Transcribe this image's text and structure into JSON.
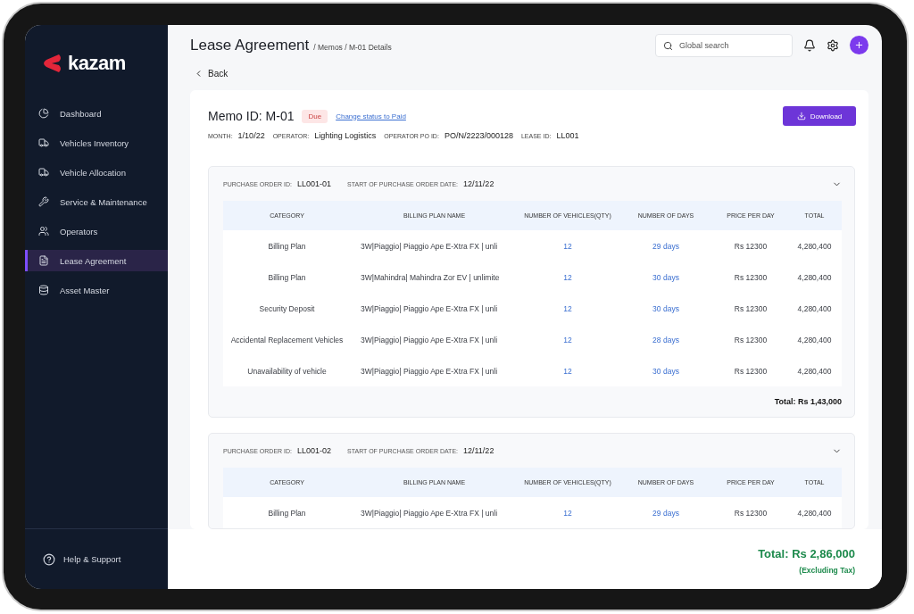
{
  "sidebar": {
    "logo": "kazam",
    "items": [
      {
        "label": "Dashboard",
        "selected": false
      },
      {
        "label": "Vehicles Inventory",
        "selected": false
      },
      {
        "label": "Vehicle Allocation",
        "selected": false
      },
      {
        "label": "Service & Maintenance",
        "selected": false
      },
      {
        "label": "Operators",
        "selected": false
      },
      {
        "label": "Lease Agreement",
        "selected": true
      },
      {
        "label": "Asset Master",
        "selected": false
      }
    ],
    "help": "Help & Support"
  },
  "header": {
    "title": "Lease Agreement",
    "breadcrumb": "/ Memos / M-01 Details",
    "search_placeholder": "Global search"
  },
  "back": "Back",
  "memo": {
    "title": "Memo ID: M-01",
    "status": "Due",
    "status_link": "Change status to Paid",
    "download": "Download",
    "meta": [
      {
        "label": "MONTH:",
        "value": "1/10/22"
      },
      {
        "label": "OPERATOR:",
        "value": "Lighting Logistics"
      },
      {
        "label": "OPERATOR PO ID:",
        "value": "PO/N/2223/000128"
      },
      {
        "label": "LEASE ID:",
        "value": "LL001"
      }
    ]
  },
  "purchase_orders": [
    {
      "id_label": "PURCHASE ORDER ID:",
      "id": "LL001-01",
      "date_label": "START OF PURCHASE ORDER DATE:",
      "date": "12/11/22",
      "columns": [
        "CATEGORY",
        "BILLING PLAN NAME",
        "NUMBER OF VEHICLES(QTY)",
        "NUMBER OF DAYS",
        "PRICE PER DAY",
        "TOTAL"
      ],
      "rows": [
        [
          "Billing Plan",
          "3W|Piaggio| Piaggio Ape E-Xtra FX | unli",
          "12",
          "29 days",
          "Rs 12300",
          "4,280,400"
        ],
        [
          "Billing Plan",
          "3W|Mahindra| Mahindra Zor EV | unlimite",
          "12",
          "30 days",
          "Rs 12300",
          "4,280,400"
        ],
        [
          "Security Deposit",
          "3W|Piaggio| Piaggio Ape E-Xtra FX | unli",
          "12",
          "30 days",
          "Rs 12300",
          "4,280,400"
        ],
        [
          "Accidental Replacement Vehicles",
          "3W|Piaggio| Piaggio Ape E-Xtra FX | unli",
          "12",
          "28 days",
          "Rs 12300",
          "4,280,400"
        ],
        [
          "Unavailability of vehicle",
          "3W|Piaggio| Piaggio Ape E-Xtra FX | unli",
          "12",
          "30 days",
          "Rs 12300",
          "4,280,400"
        ]
      ],
      "total": "Total: Rs 1,43,000"
    },
    {
      "id_label": "PURCHASE ORDER ID:",
      "id": "LL001-02",
      "date_label": "START OF PURCHASE ORDER DATE:",
      "date": "12/11/22",
      "columns": [
        "CATEGORY",
        "BILLING PLAN NAME",
        "NUMBER OF VEHICLES(QTY)",
        "NUMBER OF DAYS",
        "PRICE PER DAY",
        "TOTAL"
      ],
      "rows": [
        [
          "Billing Plan",
          "3W|Piaggio| Piaggio Ape E-Xtra FX | unli",
          "12",
          "29 days",
          "Rs 12300",
          "4,280,400"
        ]
      ]
    }
  ],
  "footer": {
    "total": "Total: Rs 2,86,000",
    "note": "(Excluding Tax)"
  }
}
